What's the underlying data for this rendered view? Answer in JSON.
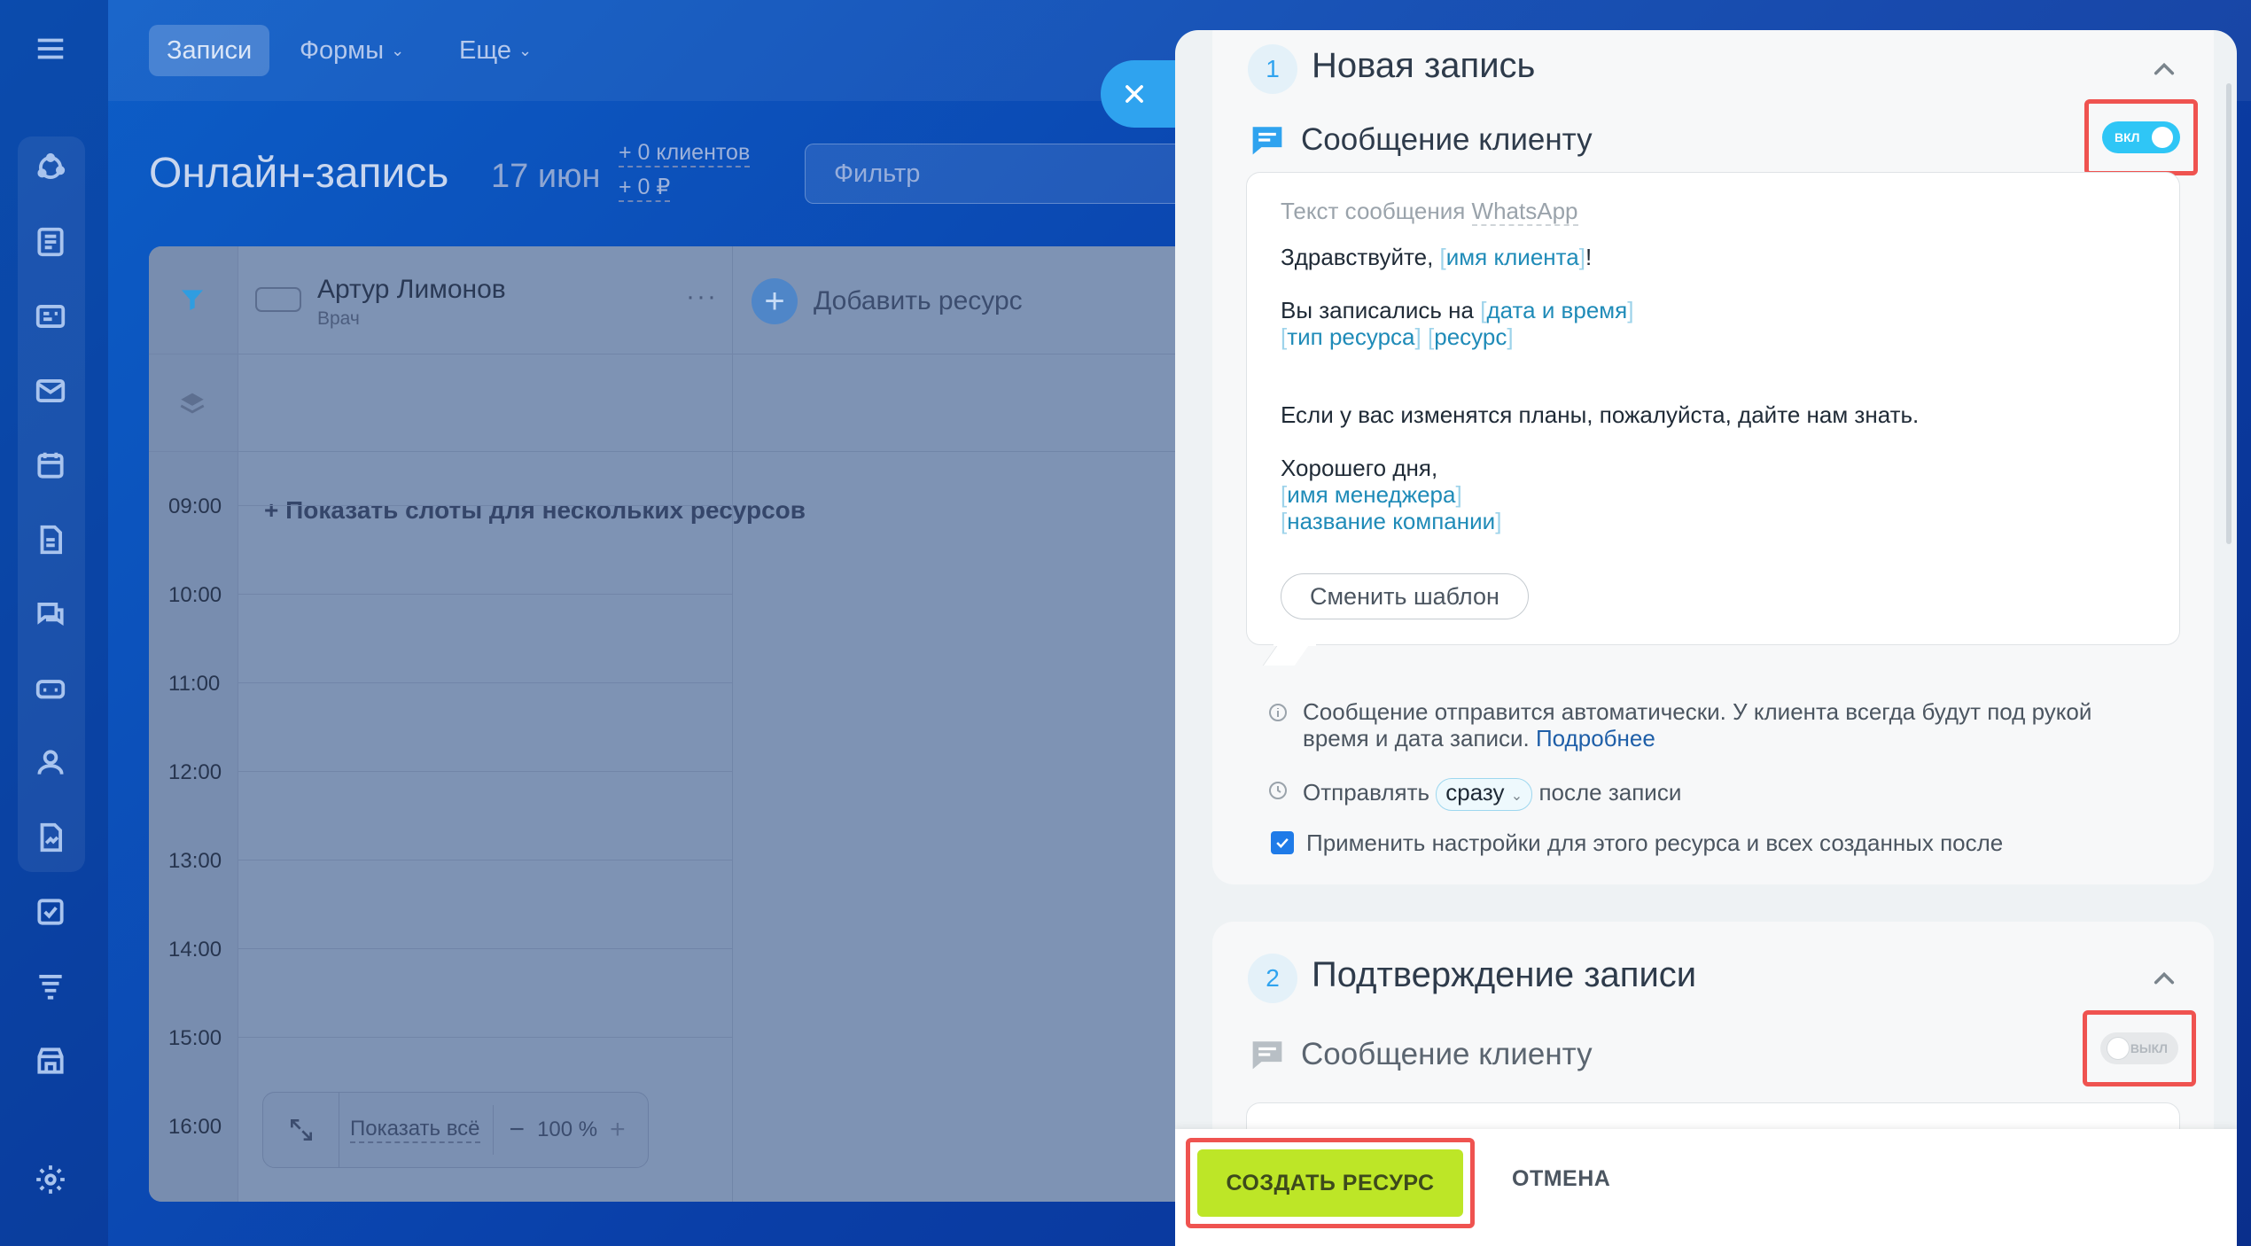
{
  "topbar": {
    "tabs": [
      {
        "label": "Записи"
      },
      {
        "label": "Формы"
      },
      {
        "label": "Еще"
      }
    ]
  },
  "page": {
    "title": "Онлайн-запись",
    "date": "17 июн",
    "stat_clients": "+ 0 клиентов",
    "stat_money": "+ 0 ₽",
    "filter_placeholder": "Фильтр"
  },
  "calendar": {
    "resource_name": "Артур Лимонов",
    "resource_role": "Врач",
    "add_resource": "Добавить ресурс",
    "show_slots": "+ Показать слоты для нескольких ресурсов",
    "times": [
      "09:00",
      "10:00",
      "11:00",
      "12:00",
      "13:00",
      "14:00",
      "15:00",
      "16:00"
    ],
    "show_all": "Показать всё",
    "zoom_minus": "−",
    "zoom": "100 %",
    "zoom_plus": "+"
  },
  "panel": {
    "section1": {
      "number": "1",
      "title": "Новая запись",
      "message_title": "Сообщение клиенту",
      "toggle_label": "ВКЛ",
      "template_prefix": "Текст сообщения",
      "template_channel": "WhatsApp",
      "greeting": "Здравствуйте,",
      "var_client_name": "имя клиента",
      "exclaim": "!",
      "booked_prefix": "Вы записались на",
      "var_datetime": "дата и время",
      "var_resource_type": "тип ресурса",
      "var_resource": "ресурс",
      "plans_text": "Если у вас изменятся планы, пожалуйста, дайте нам знать.",
      "good_day": "Хорошего дня,",
      "var_manager": "имя менеджера",
      "var_company": "название компании",
      "change_template": "Сменить шаблон",
      "info_line1": "Сообщение отправится автоматически. У клиента всегда будут под рукой",
      "info_line2": "время и дата записи.",
      "info_link": "Подробнее",
      "send_prefix": "Отправлять",
      "send_value": "сразу",
      "send_suffix": "после записи",
      "apply_label": "Применить настройки для этого ресурса и всех созданных после"
    },
    "section2": {
      "number": "2",
      "title": "Подтверждение записи",
      "message_title": "Сообщение клиенту",
      "toggle_label": "ВЫКЛ"
    },
    "footer": {
      "create_label": "СОЗДАТЬ РЕСУРС",
      "cancel_label": "ОТМЕНА"
    }
  },
  "colors": {
    "accent": "#2fc6f6",
    "create_button": "#bde627",
    "highlight": "#ef5350",
    "link": "#1f5fa8"
  },
  "icons": [
    "menu-icon",
    "funnel-icon",
    "layers-icon",
    "plus-icon",
    "chevron-up-icon",
    "message-icon",
    "info-icon",
    "clock-icon",
    "check-icon",
    "close-icon",
    "expand-icon",
    "settings-icon"
  ]
}
